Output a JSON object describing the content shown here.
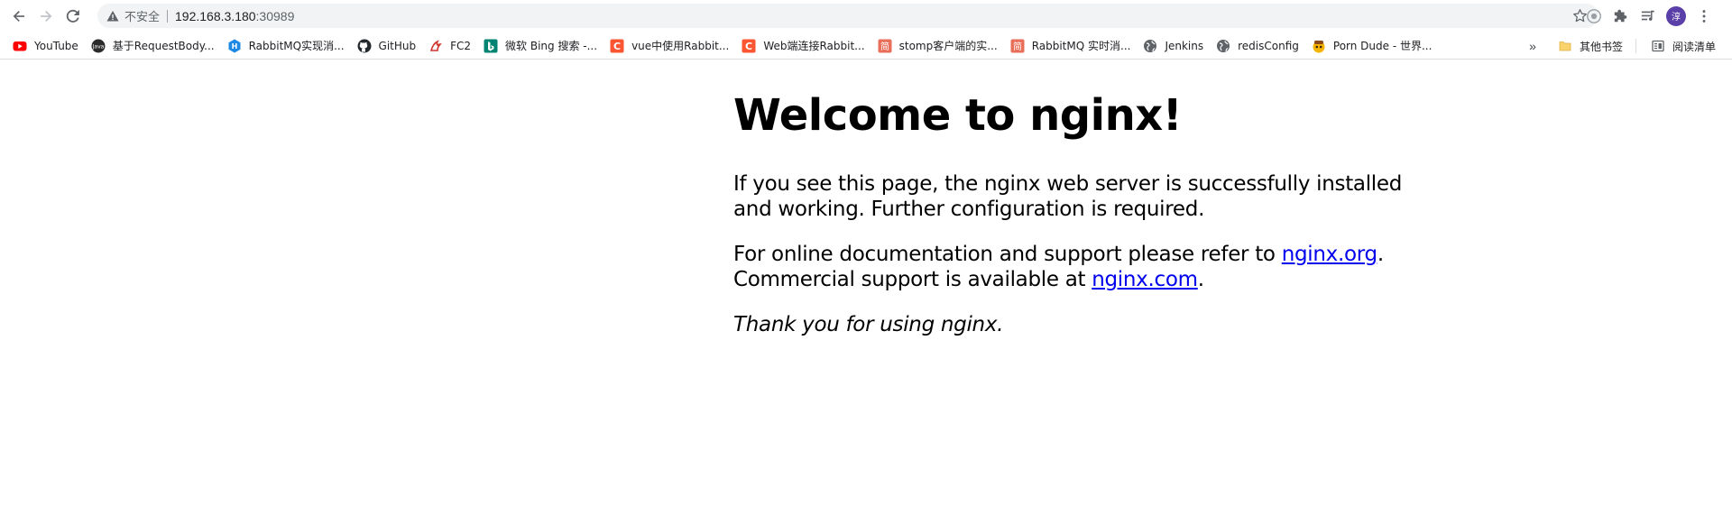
{
  "browser": {
    "security_label": "不安全",
    "url_host": "192.168.3.180",
    "url_port": ":30989",
    "avatar_initial": "淳"
  },
  "bookmarks": [
    {
      "label": "YouTube",
      "icon": "youtube-icon"
    },
    {
      "label": "基于RequestBody...",
      "icon": "java-icon"
    },
    {
      "label": "RabbitMQ实现消...",
      "icon": "hexagon-icon"
    },
    {
      "label": "GitHub",
      "icon": "github-icon"
    },
    {
      "label": "FC2",
      "icon": "fc2-icon"
    },
    {
      "label": "微软 Bing 搜索 -...",
      "icon": "bing-icon"
    },
    {
      "label": "vue中使用Rabbit...",
      "icon": "csdn-icon"
    },
    {
      "label": "Web端连接Rabbit...",
      "icon": "csdn-icon"
    },
    {
      "label": "stomp客户端的实...",
      "icon": "jianshu-icon"
    },
    {
      "label": "RabbitMQ 实时消...",
      "icon": "jianshu-icon"
    },
    {
      "label": "Jenkins",
      "icon": "globe-icon"
    },
    {
      "label": "redisConfig",
      "icon": "globe-icon"
    },
    {
      "label": "Porn Dude - 世界...",
      "icon": "porndude-icon"
    }
  ],
  "bookmarks_right": {
    "overflow": "»",
    "other_bookmarks": "其他书签",
    "reading_list": "阅读清单"
  },
  "page": {
    "heading": "Welcome to nginx!",
    "p1": "If you see this page, the nginx web server is successfully installed and working. Further configuration is required.",
    "p2_prefix": "For online documentation and support please refer to ",
    "p2_link": "nginx.org",
    "p2_mid": ".",
    "p2_line2": "Commercial support is available at ",
    "p2_link2": "nginx.com",
    "p2_end": ".",
    "p3": "Thank you for using nginx."
  },
  "colors": {
    "link": "#0000ee",
    "omnibox_bg": "#f1f3f4",
    "avatar_bg": "#5b3fa8",
    "youtube_red": "#ff0000",
    "csdn_orange": "#fc5531",
    "jianshu_red": "#ea6f5a",
    "bing_teal": "#008373",
    "hexagon_blue": "#1e88e5"
  }
}
